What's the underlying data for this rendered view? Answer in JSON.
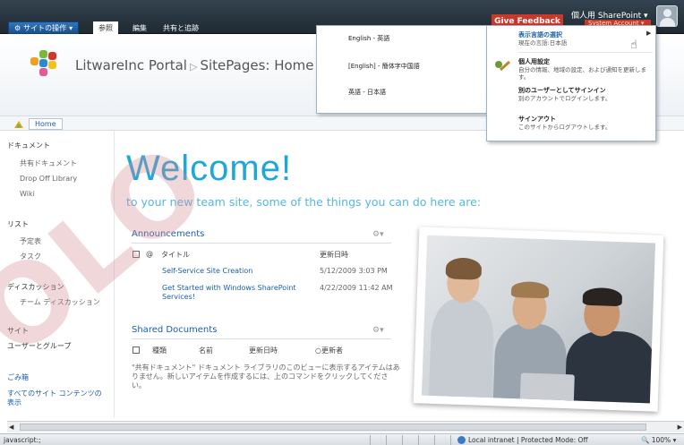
{
  "ribbon": {
    "site_actions": "サイトの操作",
    "tabs": [
      "参照",
      "編集",
      "共有と追跡"
    ],
    "give_feedback": "Give Feedback",
    "username": "個人用 SharePoint",
    "user_role": "System Account",
    "colors": {
      "feedback": "#c8392b",
      "ribbon": "#2a3842"
    }
  },
  "site": {
    "title": "LitwareInc Portal",
    "breadcrumb_page": "SitePages: Home",
    "home_button": "Home"
  },
  "leftnav": {
    "documents_header": "ドキュメント",
    "documents": [
      "共有ドキュメント",
      "Drop Off Library",
      "Wiki"
    ],
    "lists_header": "リスト",
    "lists": [
      "予定表",
      "タスク"
    ],
    "discussions_header": "ディスカッション",
    "discussions": [
      "チーム ディスカッション"
    ],
    "sites_header": "サイト",
    "sites": [
      "ユーザーとグループ"
    ],
    "recycle_bin": "ごみ箱",
    "all_content": "すべてのサイト コンテンツの表示"
  },
  "main": {
    "welcome": "Welcome!",
    "welcome_sub": "to your new team site, some of the things you can do here are:",
    "announcements": {
      "title": "Announcements",
      "col_title": "タイトル",
      "col_modified": "更新日時",
      "rows": [
        {
          "title": "Self-Service Site Creation",
          "date": "5/12/2009 3:03 PM"
        },
        {
          "title": "Get Started with Windows SharePoint Services!",
          "date": "4/22/2009 11:42 AM"
        }
      ]
    },
    "shared_documents": {
      "title": "Shared Documents",
      "col_type": "種類",
      "col_name": "名前",
      "col_modified": "更新日時",
      "col_modified_by": "更新者",
      "empty_message": "\"共有ドキュメント\" ドキュメント ライブラリのこのビューに表示するアイテムはありません。新しいアイテムを作成するには、上のコマンドをクリックしてください。"
    }
  },
  "language_menu": {
    "items": [
      "English - 英語",
      "[English] - 簡体字中国語",
      "英語 - 日本語"
    ]
  },
  "user_menu": {
    "items": [
      {
        "title": "表示言語の選択",
        "desc": "現在の言語:日本語"
      },
      {
        "title": "個人用設定",
        "desc": "自分の情報、地域の設定、および通知を更新します。"
      },
      {
        "title": "別のユーザーとしてサインイン",
        "desc": "別のアカウントでログインします。"
      },
      {
        "title": "サインアウト",
        "desc": "このサイトからログアウトします。"
      }
    ]
  },
  "status": {
    "left": "javascript:;",
    "zone": "Local intranet | Protected Mode: Off",
    "zoom": "100%"
  },
  "watermark": "OLO"
}
